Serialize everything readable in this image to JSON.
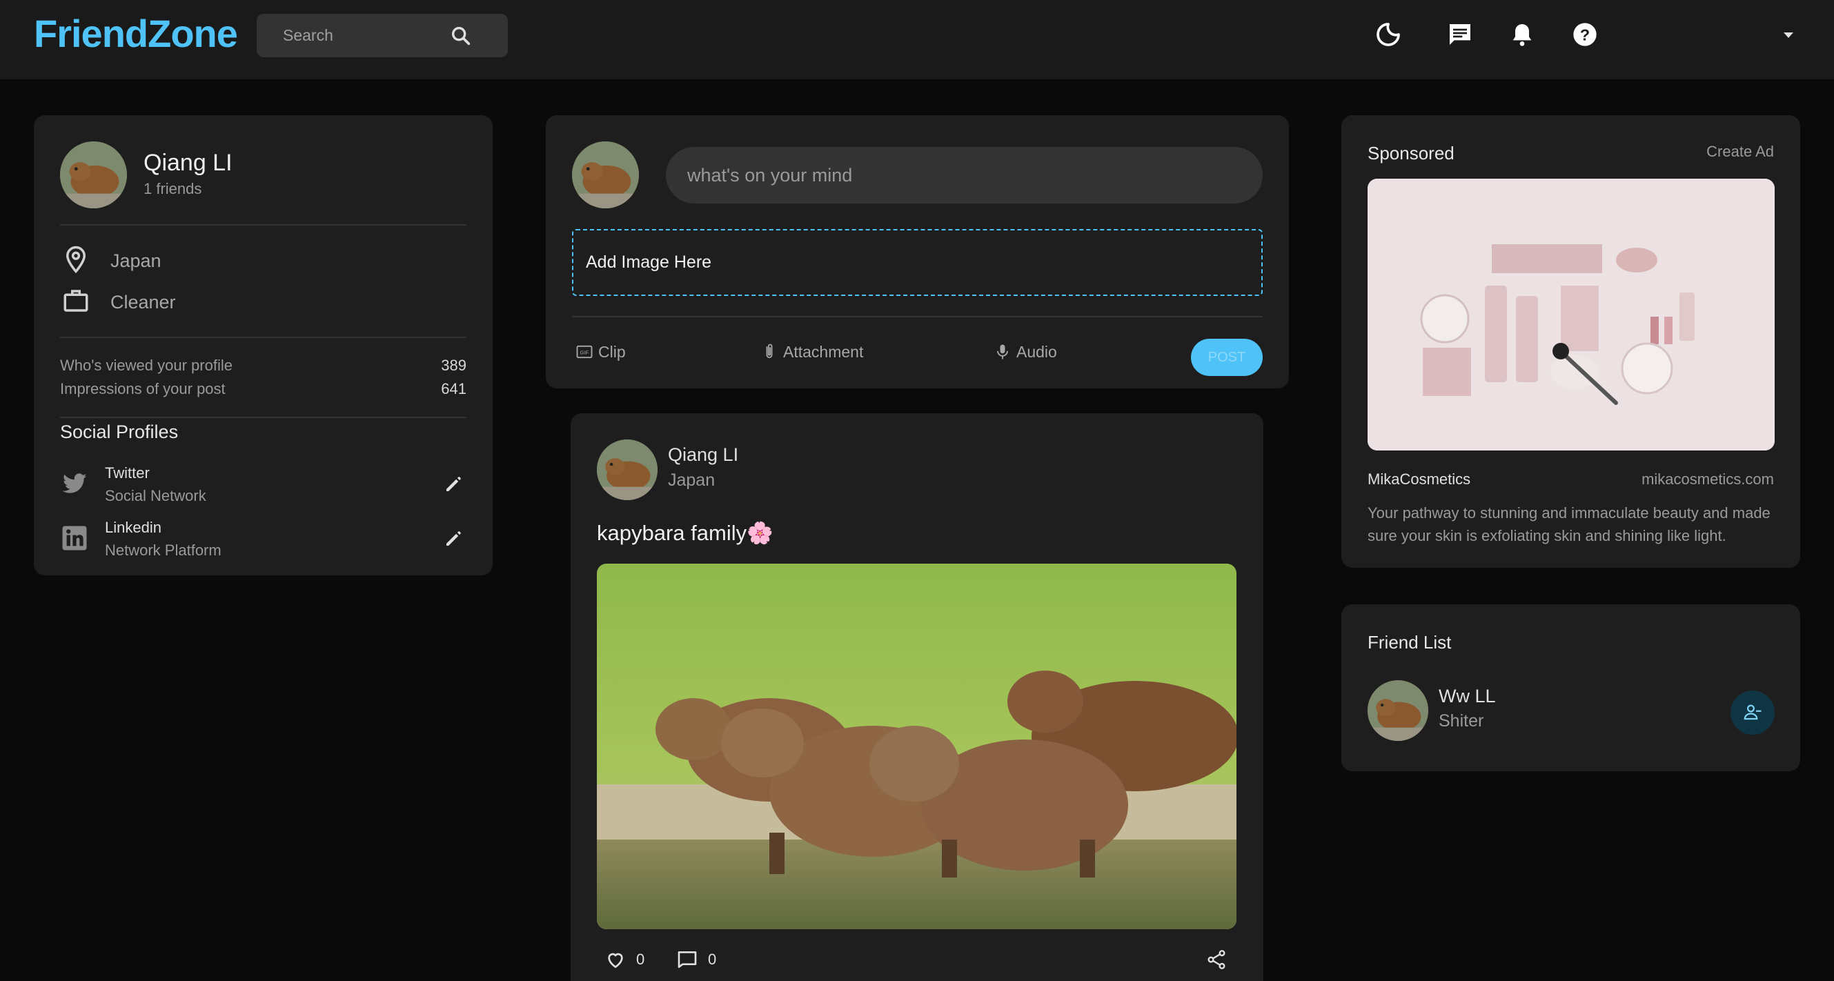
{
  "header": {
    "logo": "FriendZone",
    "search_placeholder": "Search",
    "icons": [
      "search-icon",
      "dark-mode-icon",
      "message-icon",
      "notifications-icon",
      "help-icon",
      "caret-down-icon"
    ]
  },
  "profile": {
    "name": "Qiang LI",
    "friends": "1 friends",
    "location": "Japan",
    "occupation": "Cleaner",
    "stats": [
      {
        "label": "Who's viewed your profile",
        "value": "389"
      },
      {
        "label": "Impressions of your post",
        "value": "641"
      }
    ],
    "social_title": "Social Profiles",
    "socials": [
      {
        "name": "Twitter",
        "sub": "Social Network",
        "icon": "twitter-icon"
      },
      {
        "name": "Linkedin",
        "sub": "Network Platform",
        "icon": "linkedin-icon"
      }
    ]
  },
  "composer": {
    "placeholder": "what's on your mind",
    "dropzone": "Add Image Here",
    "actions": [
      "Clip",
      "Attachment",
      "Audio"
    ],
    "post_label": "POST"
  },
  "post": {
    "author": "Qiang LI",
    "location": "Japan",
    "text": "kapybara family🌸",
    "likes": "0",
    "comments": "0"
  },
  "sponsored": {
    "title": "Sponsored",
    "create": "Create Ad",
    "brand": "MikaCosmetics",
    "url": "mikacosmetics.com",
    "description": "Your pathway to stunning and immaculate beauty and made sure your skin is exfoliating skin and shining like light."
  },
  "friend_list": {
    "title": "Friend List",
    "friends": [
      {
        "name": "Ww LL",
        "sub": "Shiter"
      }
    ]
  },
  "colors": {
    "accent": "#4fc3f7",
    "background": "#0a0a0a",
    "card": "#1e1e1e",
    "navbar": "#1a1a1a"
  }
}
